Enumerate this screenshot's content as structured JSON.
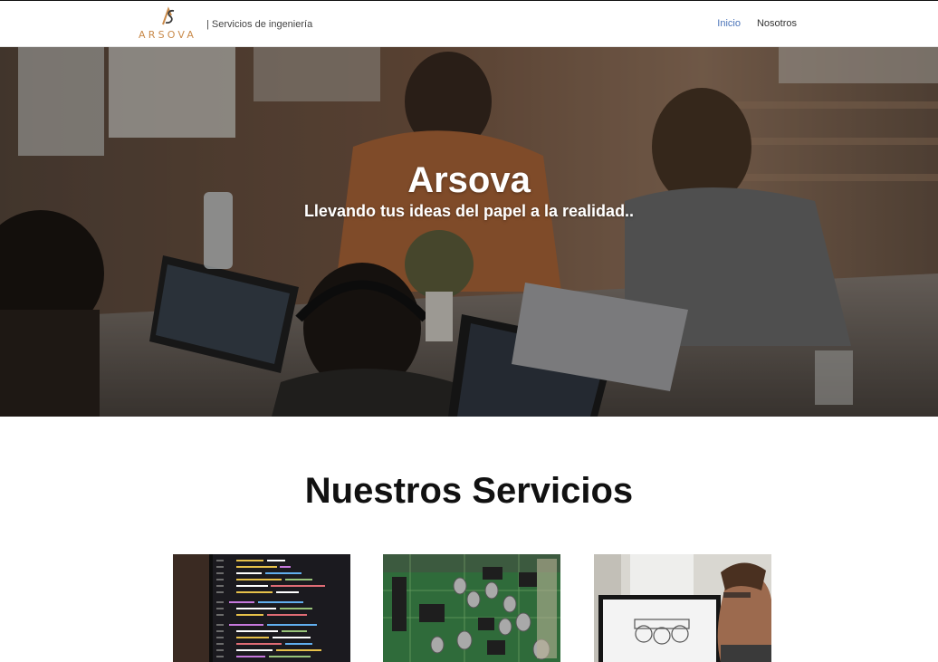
{
  "navbar": {
    "logo_text": "ARSOVA",
    "tagline": "| Servicios de ingeniería",
    "links": [
      {
        "label": "Inicio",
        "active": true
      },
      {
        "label": "Nosotros",
        "active": false
      }
    ],
    "accent_color": "#4a73b8",
    "logo_color": "#c98a4a"
  },
  "hero": {
    "title": "Arsova",
    "subtitle": "Llevando tus ideas del papel a la realidad.."
  },
  "services": {
    "title": "Nuestros Servicios",
    "cards": [
      {
        "image": "code-on-screen-image"
      },
      {
        "image": "circuit-board-image"
      },
      {
        "image": "cad-workstation-image"
      }
    ]
  }
}
